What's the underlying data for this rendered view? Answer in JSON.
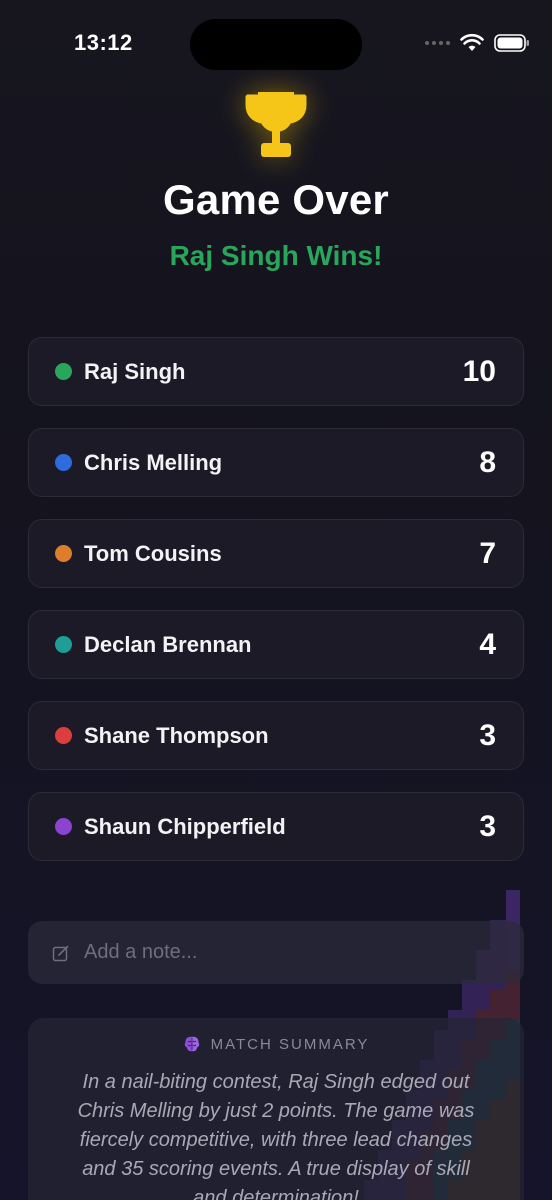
{
  "status_bar": {
    "time": "13:12"
  },
  "header": {
    "title": "Game Over",
    "winner_text": "Raj Singh Wins!",
    "trophy_color": "#f5c518"
  },
  "players": [
    {
      "name": "Raj Singh",
      "score": "10",
      "color": "#2aa55c"
    },
    {
      "name": "Chris Melling",
      "score": "8",
      "color": "#2f6bdc"
    },
    {
      "name": "Tom Cousins",
      "score": "7",
      "color": "#e07d2a"
    },
    {
      "name": "Declan Brennan",
      "score": "4",
      "color": "#1f9d98"
    },
    {
      "name": "Shane Thompson",
      "score": "3",
      "color": "#dd3d3d"
    },
    {
      "name": "Shaun Chipperfield",
      "score": "3",
      "color": "#8a44d0"
    }
  ],
  "note": {
    "placeholder": "Add a note..."
  },
  "summary": {
    "label": "MATCH SUMMARY",
    "text": "In a nail-biting contest, Raj Singh edged out Chris Melling by just 2 points. The game was fiercely competitive, with three lead changes and 35 scoring events. A true display of skill and determination!"
  }
}
